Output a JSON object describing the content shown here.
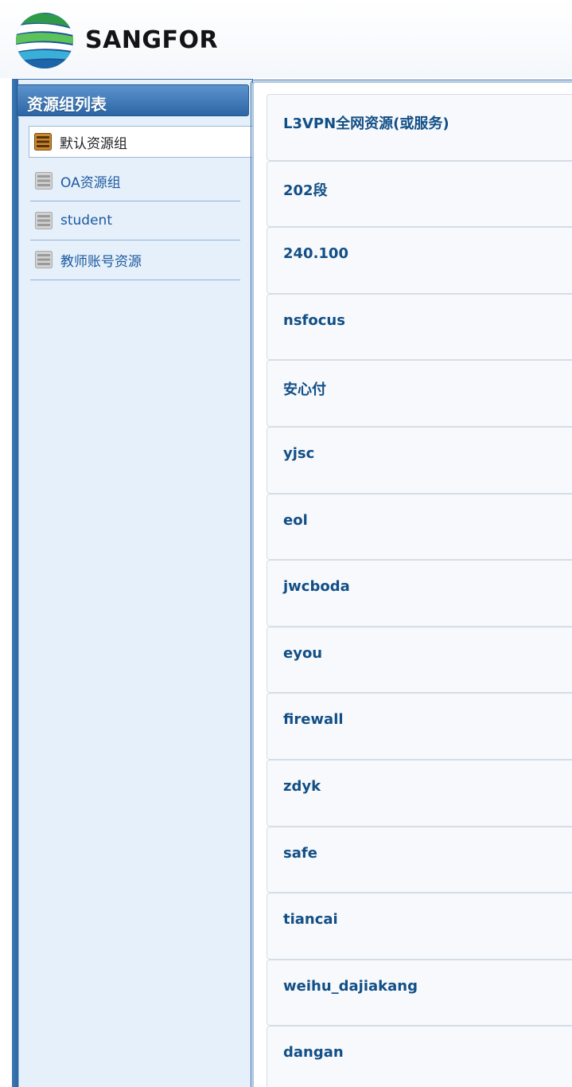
{
  "header": {
    "brand": "SANGFOR"
  },
  "sidebar": {
    "title": "资源组列表",
    "items": [
      {
        "label": "默认资源组",
        "active": true
      },
      {
        "label": "OA资源组",
        "active": false
      },
      {
        "label": "student",
        "active": false
      },
      {
        "label": "教师账号资源",
        "active": false
      }
    ]
  },
  "resources": [
    {
      "name": "L3VPN全网资源(或服务)"
    },
    {
      "name": "202段"
    },
    {
      "name": "240.100"
    },
    {
      "name": "nsfocus"
    },
    {
      "name": "安心付"
    },
    {
      "name": "yjsc"
    },
    {
      "name": "eol"
    },
    {
      "name": "jwcboda"
    },
    {
      "name": "eyou"
    },
    {
      "name": "firewall"
    },
    {
      "name": "zdyk"
    },
    {
      "name": "safe"
    },
    {
      "name": "tiancai"
    },
    {
      "name": "weihu_dajiakang"
    },
    {
      "name": "dangan"
    }
  ],
  "colors": {
    "accent": "#2c66a4",
    "link": "#124f86",
    "sidebar_bg": "#e6f0fa"
  },
  "icons": {
    "logo": "sangfor-globe-logo",
    "group": "resource-group-icon"
  }
}
